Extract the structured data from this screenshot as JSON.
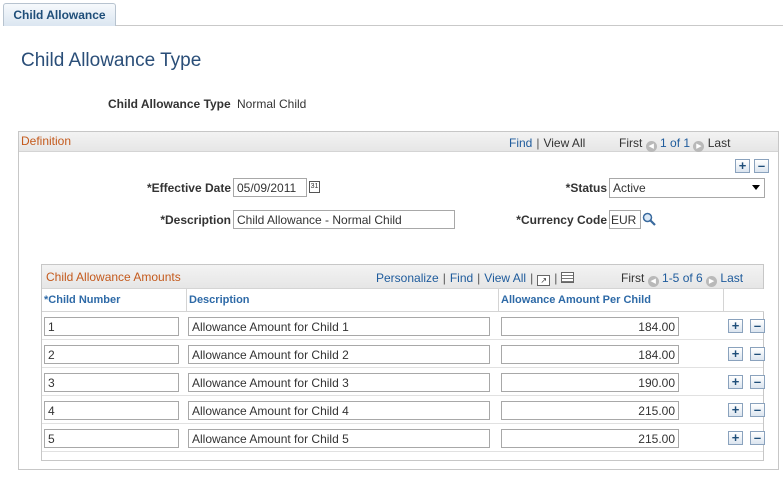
{
  "tab": {
    "label": "Child Allowance"
  },
  "page": {
    "title": "Child Allowance Type",
    "key_label": "Child Allowance Type",
    "key_value": "Normal Child"
  },
  "definition": {
    "title": "Definition",
    "nav": {
      "find": "Find",
      "view_all": "View All",
      "first": "First",
      "range": "1 of 1",
      "last": "Last"
    },
    "effective_date": {
      "label": "*Effective Date",
      "value": "05/09/2011"
    },
    "status": {
      "label": "*Status",
      "value": "Active"
    },
    "description": {
      "label": "*Description",
      "value": "Child Allowance - Normal Child"
    },
    "currency_code": {
      "label": "*Currency Code",
      "value": "EUR"
    }
  },
  "amounts": {
    "title": "Child Allowance Amounts",
    "nav": {
      "personalize": "Personalize",
      "find": "Find",
      "view_all": "View All",
      "first": "First",
      "range": "1-5 of 6",
      "last": "Last"
    },
    "columns": {
      "child_number": "*Child Number",
      "description": "Description",
      "amount": "Allowance Amount Per Child"
    },
    "rows": [
      {
        "child_number": "1",
        "description": "Allowance Amount for Child 1",
        "amount": "184.00"
      },
      {
        "child_number": "2",
        "description": "Allowance Amount for Child 2",
        "amount": "184.00"
      },
      {
        "child_number": "3",
        "description": "Allowance Amount for Child 3",
        "amount": "190.00"
      },
      {
        "child_number": "4",
        "description": "Allowance Amount for Child 4",
        "amount": "215.00"
      },
      {
        "child_number": "5",
        "description": "Allowance Amount for Child 5",
        "amount": "215.00"
      }
    ]
  },
  "icons": {
    "add": "plus-icon",
    "delete": "minus-icon",
    "calendar": "calendar-icon",
    "lookup": "magnifier-icon",
    "zoom": "zoom-icon",
    "download": "grid-download-icon",
    "prev": "arrow-left-icon",
    "next": "arrow-right-icon"
  },
  "colors": {
    "title": "#2a4e78",
    "section_title": "#c45a1d",
    "link": "#1e5b9c",
    "column_header": "#2e6aa7"
  }
}
